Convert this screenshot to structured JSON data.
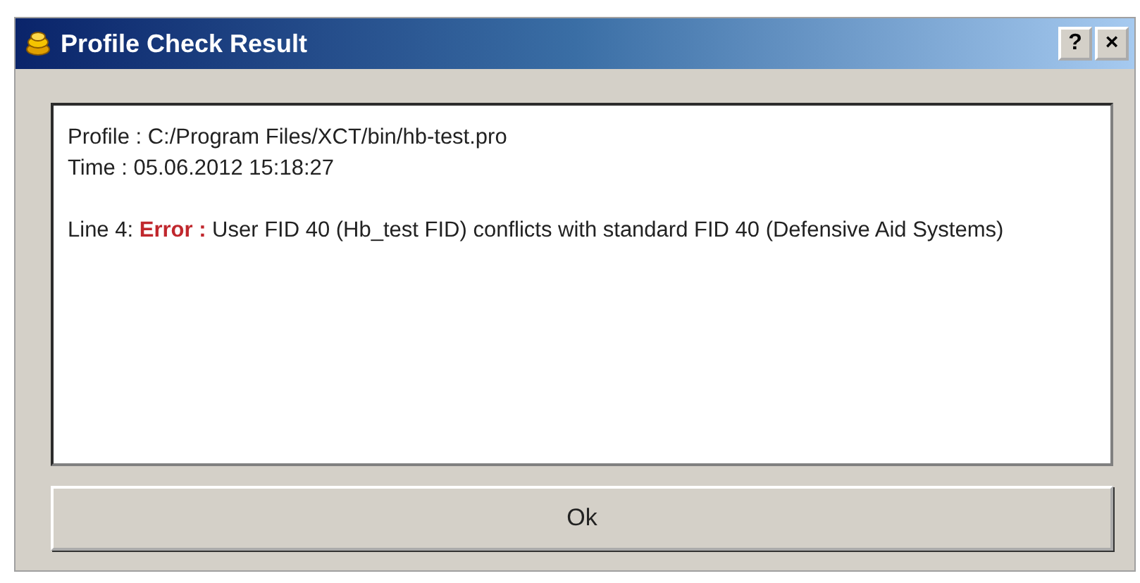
{
  "window": {
    "title": "Profile Check Result",
    "title_buttons": [
      "?",
      "×"
    ]
  },
  "report": {
    "header_lines": [
      "Profile : C:/Program Files/XCT/bin/hb-test.pro",
      "Time : 05.06.2012 15:18:27"
    ],
    "messages": [
      "Line 4: **Error :** User FID 40 (Hb_test FID) conflicts with standard FID 40 (Defensive Aid Systems)"
    ]
  },
  "buttons": [
    "Ok"
  ]
}
